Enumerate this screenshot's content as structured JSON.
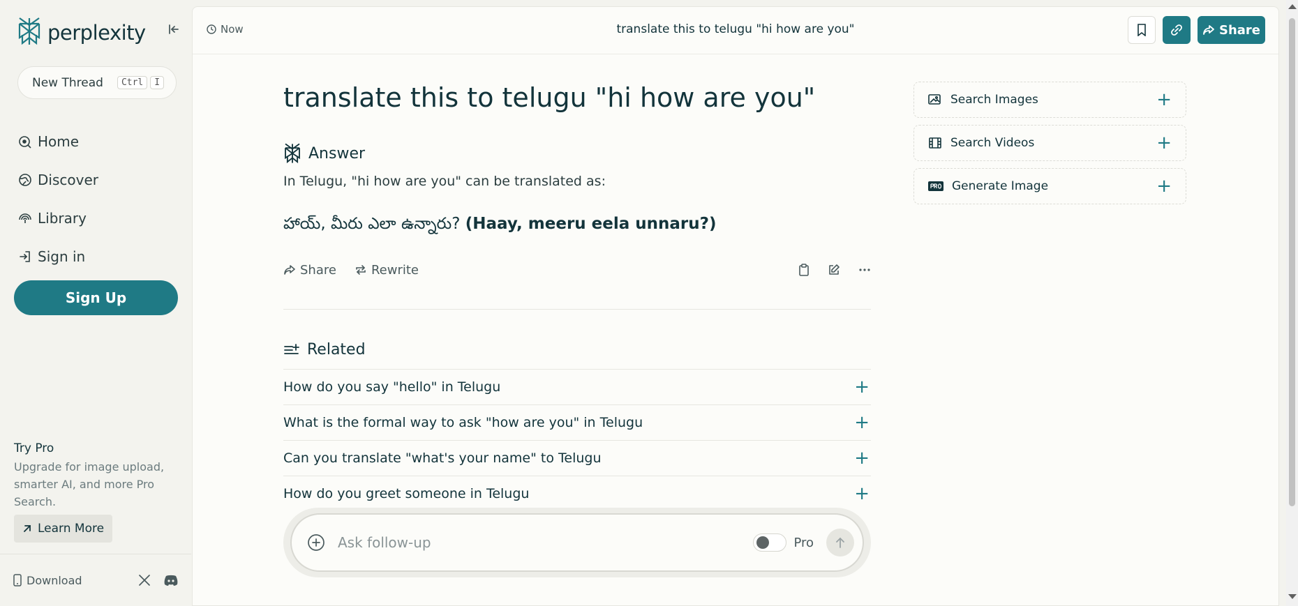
{
  "sidebar": {
    "logo_text": "perplexity",
    "new_thread_label": "New Thread",
    "shortcut_keys": [
      "Ctrl",
      "I"
    ],
    "nav": [
      {
        "label": "Home",
        "icon": "home-icon"
      },
      {
        "label": "Discover",
        "icon": "globe-icon"
      },
      {
        "label": "Library",
        "icon": "library-icon"
      },
      {
        "label": "Sign in",
        "icon": "sign-in-icon"
      }
    ],
    "signup_label": "Sign Up",
    "try_pro_title": "Try Pro",
    "try_pro_desc": "Upgrade for image upload, smarter AI, and more Pro Search.",
    "learn_more_label": "Learn More",
    "download_label": "Download"
  },
  "topbar": {
    "time_label": "Now",
    "title": "translate this to telugu \"hi how are you\"",
    "share_label": "Share"
  },
  "thread": {
    "question": "translate this to telugu \"hi how are you\"",
    "answer_heading": "Answer",
    "answer_intro": "In Telugu, \"hi how are you\" can be translated as:",
    "answer_telugu": "హాయ్, మీరు ఎలా ఉన్నారు?",
    "answer_translit": "(Haay, meeru eela unnaru?)",
    "actions": {
      "share": "Share",
      "rewrite": "Rewrite"
    },
    "related_heading": "Related",
    "related": [
      "How do you say \"hello\" in Telugu",
      "What is the formal way to ask \"how are you\" in Telugu",
      "Can you translate \"what's your name\" to Telugu",
      "How do you greet someone in Telugu"
    ],
    "followup_placeholder": "Ask follow-up",
    "pro_label": "Pro"
  },
  "side_cards": [
    {
      "label": "Search Images",
      "icon": "image-icon"
    },
    {
      "label": "Search Videos",
      "icon": "video-icon"
    },
    {
      "label": "Generate Image",
      "icon": "pro-badge-icon"
    }
  ],
  "help_label": "?",
  "colors": {
    "accent": "#1f7a85",
    "text": "#13343b",
    "background": "#f3f3ee"
  }
}
